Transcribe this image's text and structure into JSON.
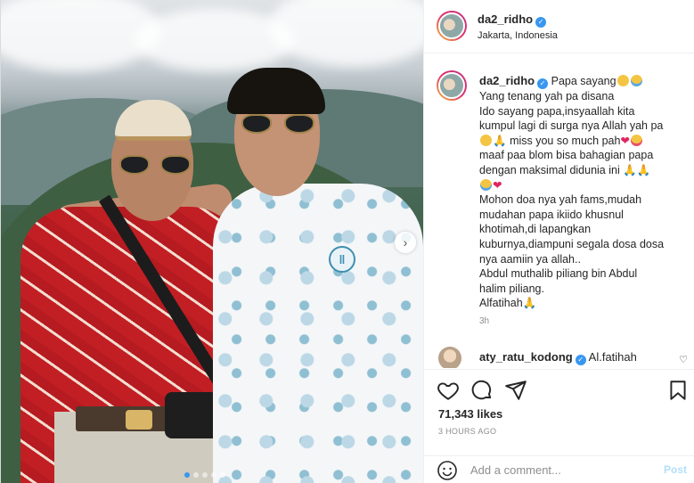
{
  "post": {
    "author": "da2_ridho",
    "location": "Jakarta, Indonesia",
    "verified_icon": "verified-badge-icon",
    "carousel_dots": 5,
    "carousel_active": 1
  },
  "caption": {
    "author": "da2_ridho",
    "lines": [
      "Papa sayang",
      "Yang tenang yah pa disana",
      "Ido sayang papa,insyaallah kita",
      "kumpul lagi di surga nya Allah yah pa",
      "miss you so much pah",
      "maaf paa blom bisa bahagian papa",
      "dengan maksimal didunia ini",
      "",
      "Mohon doa nya yah fams,mudah",
      "mudahan papa ikiido khusnul",
      "khotimah,di lapangkan",
      "kuburnya,diampuni segala dosa dosa",
      "nya aamiin ya allah..",
      "Abdul muthalib piliang bin Abdul",
      "halim piliang.",
      "Alfatihah"
    ],
    "time_ago": "3h"
  },
  "comment": {
    "author": "aty_ratu_kodong",
    "text": "Al.fatihah"
  },
  "actions": {
    "likes": "71,343 likes",
    "posted": "3 HOURS AGO",
    "comment_placeholder": "Add a comment...",
    "post_label": "Post"
  },
  "colors": {
    "accent": "#3897f0",
    "post_disabled": "#b2dffc",
    "heart": "#e0245e",
    "muted": "#8e8e8e"
  }
}
